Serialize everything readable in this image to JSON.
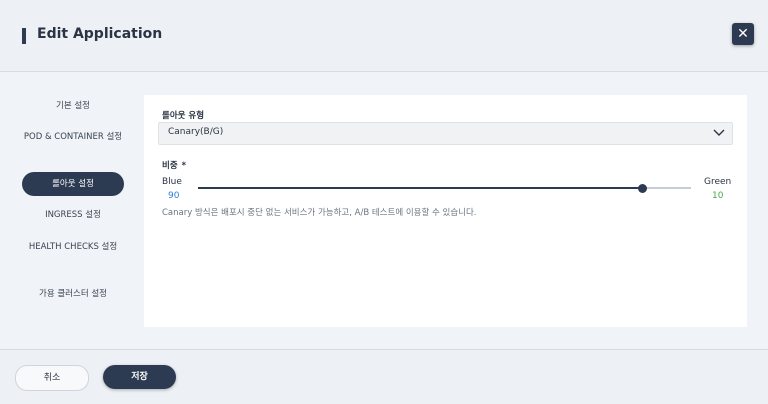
{
  "header": {
    "title": "Edit Application",
    "close_icon": "close-icon"
  },
  "sidebar": {
    "items": [
      {
        "label": "기본 설정",
        "active": false
      },
      {
        "label": "POD & CONTAINER 설정",
        "active": false
      },
      {
        "label": "롤아웃 설정",
        "active": true
      },
      {
        "label": "INGRESS 설정",
        "active": false
      },
      {
        "label": "HEALTH CHECKS 설정",
        "active": false
      },
      {
        "label": "가용 클러스터 설정",
        "active": false
      }
    ]
  },
  "rollout": {
    "type_label": "롤아웃 유형",
    "type_value": "Canary(B/G)",
    "weight_label": "비중",
    "required_mark": "*",
    "left_label": "Blue",
    "right_label": "Green",
    "left_value": "90",
    "right_value": "10",
    "slider_fraction": 0.9,
    "description": "Canary 방식은 배포시 중단 없는 서비스가 가능하고, A/B 테스트에 이용할 수 있습니다."
  },
  "footer": {
    "cancel_label": "취소",
    "save_label": "저장"
  },
  "colors": {
    "accent": "#2c3a52",
    "blue_value": "#2f7fd0",
    "green_value": "#4aa845"
  }
}
